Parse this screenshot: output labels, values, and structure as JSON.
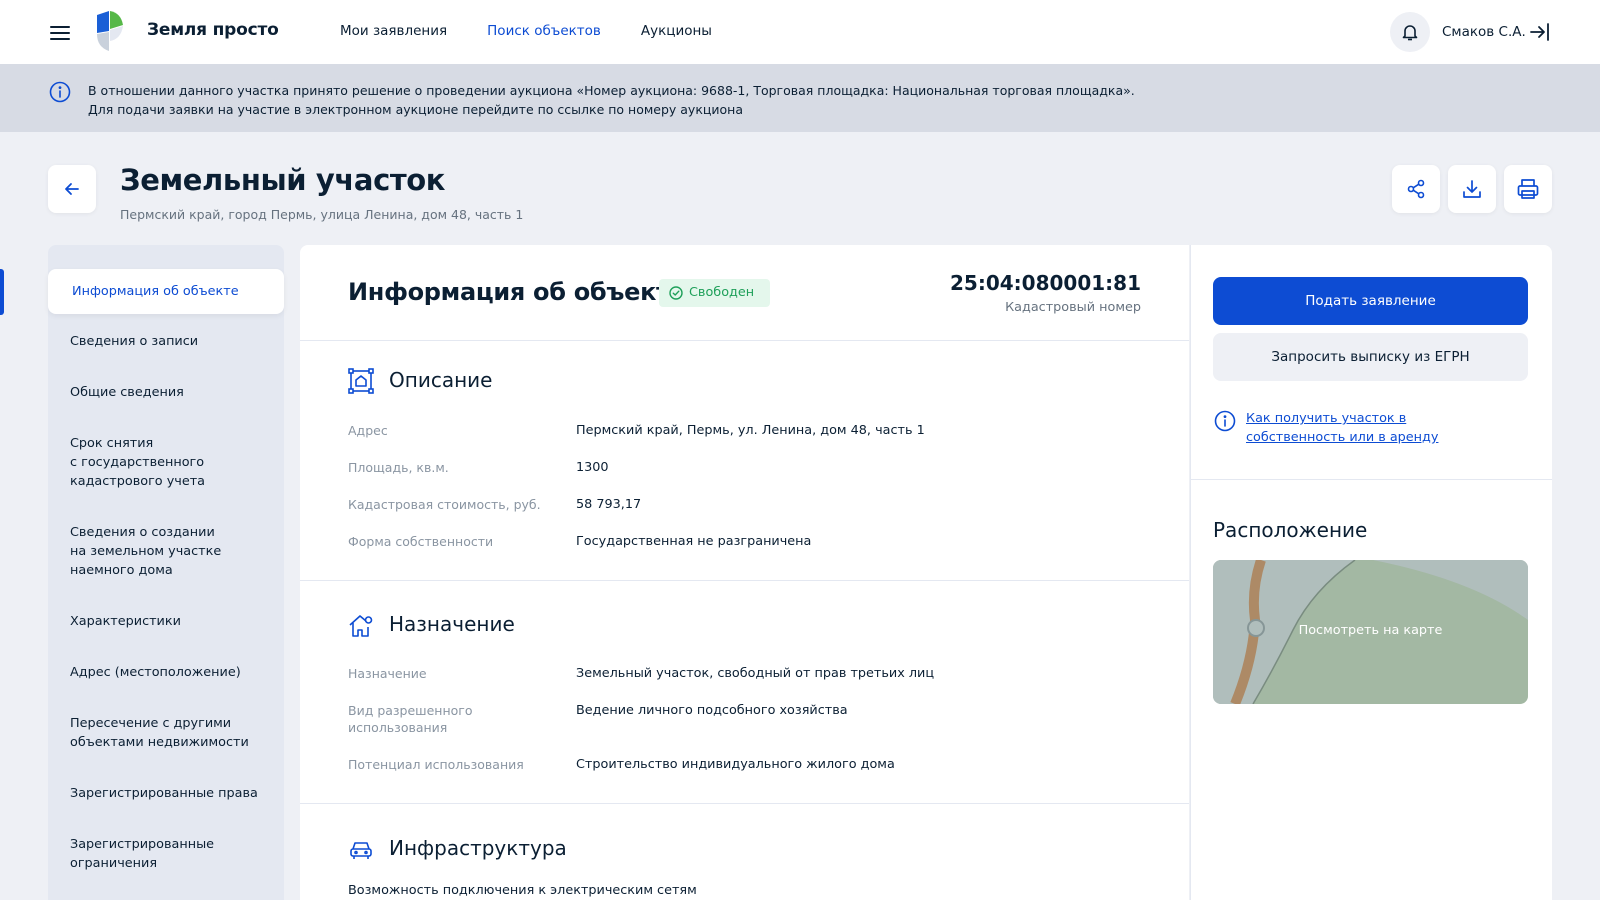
{
  "header": {
    "brand": "Земля просто",
    "nav": [
      "Мои заявления",
      "Поиск объектов",
      "Аукционы"
    ],
    "user": "Смаков С.А."
  },
  "banner": {
    "line1": "В отношении данного участка принято решение о проведении аукциона «Номер аукциона: 9688-1, Торговая площадка: Национальная торговая площадка».",
    "line2": "Для подачи заявки на участие в электронном аукционе перейдите по ссылке по номеру аукциона"
  },
  "page": {
    "title": "Земельный участок",
    "subtitle": "Пермский край, город Пермь, улица Ленина, дом 48, часть 1"
  },
  "sidebar": {
    "items": [
      "Информация об объекте",
      "Сведения о записи",
      "Общие сведения",
      "Срок снятия\nс государственного\nкадастрового учета",
      "Сведения о создании\nна земельном участке\nнаемного дома",
      "Характеристики",
      "Адрес (местоположение)",
      "Пересечение с другими\nобъектами недвижимости",
      "Зарегистрированные права",
      "Зарегистрированные\nограничения"
    ]
  },
  "main": {
    "title": "Информация об объекте",
    "status": "Свободен",
    "cadastral_number": "25:04:080001:81",
    "cadastral_label": "Кадастровый номер",
    "description": {
      "title": "Описание",
      "rows": [
        {
          "label": "Адрес",
          "value": "Пермский край, Пермь, ул. Ленина, дом 48, часть 1"
        },
        {
          "label": "Площадь, кв.м.",
          "value": "1300"
        },
        {
          "label": "Кадастровая стоимость, руб.",
          "value": "58 793,17"
        },
        {
          "label": "Форма собственности",
          "value": "Государственная не разграничена"
        }
      ]
    },
    "purpose": {
      "title": "Назначение",
      "rows": [
        {
          "label": "Назначение",
          "value": "Земельный участок, свободный от прав третьих лиц"
        },
        {
          "label": "Вид разрешенного\nиспользования",
          "value": "Ведение личного подсобного хозяйства"
        },
        {
          "label": "Потенциал использования",
          "value": "Строительство индивидуального жилого дома"
        }
      ]
    },
    "infrastructure": {
      "title": "Инфраструктура",
      "first_item": "Возможность подключения к электрическим сетям"
    }
  },
  "right": {
    "submit": "Подать заявление",
    "request": "Запросить выписку из ЕГРН",
    "help_link": "Как получить участок в собственность или в аренду",
    "location_title": "Расположение",
    "map_label": "Посмотреть на карте"
  },
  "colors": {
    "accent": "#0d4cd3",
    "status_green": "#1fa05a",
    "text": "#0b1f33",
    "muted": "#66727f"
  }
}
